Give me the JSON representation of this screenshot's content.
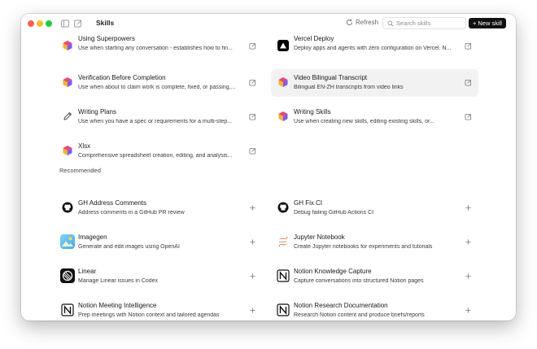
{
  "window": {
    "title": "Skills",
    "refresh_label": "Refresh",
    "search_placeholder": "Search skills",
    "new_skill_label": "New skill"
  },
  "installed": [
    {
      "title": "Using Superpowers",
      "desc": "Use when starting any conversation - establishes how to fin...",
      "icon": "skill-cube-icon",
      "action": "edit-icon"
    },
    {
      "title": "Vercel Deploy",
      "desc": "Deploy apps and agents with zero configuration on Vercel. N...",
      "icon": "vercel-triangle-icon",
      "action": "edit-icon"
    },
    {
      "title": "Verification Before Completion",
      "desc": "Use when about to claim work is complete, fixed, or passing,...",
      "icon": "skill-cube-icon",
      "action": "edit-icon"
    },
    {
      "title": "Video Bilingual Transcript",
      "desc": "Bilingual EN-ZH transcripts from video links",
      "icon": "skill-cube-icon",
      "action": "edit-icon"
    },
    {
      "title": "Writing Plans",
      "desc": "Use when you have a spec or requirements for a multi-step...",
      "icon": "pencil-icon",
      "action": "edit-icon"
    },
    {
      "title": "Writing Skills",
      "desc": "Use when creating new skills, editing existing skills, or...",
      "icon": "skill-cube-icon",
      "action": "edit-icon"
    },
    {
      "title": "Xlsx",
      "desc": "Comprehensive spreadsheet creation, editing, and analysis...",
      "icon": "skill-cube-icon",
      "action": "edit-icon"
    }
  ],
  "recommended_label": "Recommended",
  "recommended": [
    {
      "title": "GH Address Comments",
      "desc": "Address comments in a GitHub PR review",
      "icon": "github-icon",
      "action": "plus-icon"
    },
    {
      "title": "GH Fix CI",
      "desc": "Debug failing GitHub Actions CI",
      "icon": "github-icon",
      "action": "plus-icon"
    },
    {
      "title": "Imagegen",
      "desc": "Generate and edit images using OpenAI",
      "icon": "image-icon",
      "action": "plus-icon"
    },
    {
      "title": "Jupyter Notebook",
      "desc": "Create Jupyter notebooks for experiments and tutorials",
      "icon": "jupyter-icon",
      "action": "plus-icon"
    },
    {
      "title": "Linear",
      "desc": "Manage Linear issues in Codex",
      "icon": "linear-icon",
      "action": "plus-icon"
    },
    {
      "title": "Notion Knowledge Capture",
      "desc": "Capture conversations into structured Notion pages",
      "icon": "notion-icon",
      "action": "plus-icon"
    },
    {
      "title": "Notion Meeting Intelligence",
      "desc": "Prep meetings with Notion context and tailored agendas",
      "icon": "notion-icon",
      "action": "plus-icon"
    },
    {
      "title": "Notion Research Documentation",
      "desc": "Research Notion content and produce briefs/reports",
      "icon": "notion-icon",
      "action": "plus-icon"
    }
  ],
  "colors": {
    "accent": "#111111",
    "highlight": "#f2f2f2",
    "close": "#fe5f57",
    "minimize": "#febc2e",
    "zoom": "#28c840"
  }
}
